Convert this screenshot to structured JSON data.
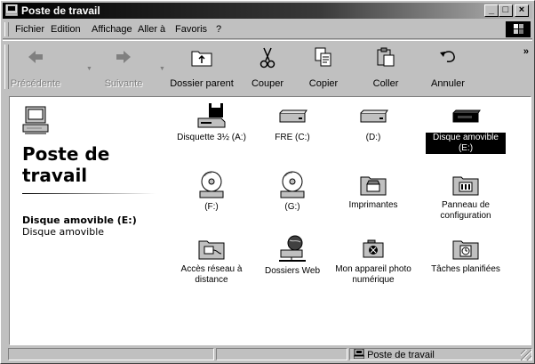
{
  "window": {
    "title": "Poste de travail"
  },
  "menu": [
    {
      "label": "Fichier"
    },
    {
      "label": "Edition"
    },
    {
      "label": "Affichage"
    },
    {
      "label": "Aller à"
    },
    {
      "label": "Favoris"
    },
    {
      "label": "?"
    }
  ],
  "toolbar": {
    "back": "Précédente",
    "forward": "Suivante",
    "parent": "Dossier parent",
    "cut": "Couper",
    "copy": "Copier",
    "paste": "Coller",
    "undo": "Annuler",
    "more": "»"
  },
  "left_pane": {
    "title_line1": "Poste de",
    "title_line2": "travail",
    "selected_name": "Disque amovible (E:)",
    "selected_type": "Disque amovible"
  },
  "items": [
    {
      "label": "Disquette 3½ (A:)",
      "icon": "floppy-drive-icon"
    },
    {
      "label": "FRE (C:)",
      "icon": "hard-drive-icon"
    },
    {
      "label": "(D:)",
      "icon": "hard-drive-icon"
    },
    {
      "label": "Disque amovible (E:)",
      "icon": "removable-disk-icon",
      "selected": true
    },
    {
      "label": "(F:)",
      "icon": "cd-drive-icon"
    },
    {
      "label": "(G:)",
      "icon": "cd-drive-icon"
    },
    {
      "label": "Imprimantes",
      "icon": "printers-folder-icon"
    },
    {
      "label": "Panneau de configuration",
      "icon": "control-panel-icon"
    },
    {
      "label": "Accès réseau à distance",
      "icon": "dialup-networking-icon"
    },
    {
      "label": "Dossiers Web",
      "icon": "web-folders-icon"
    },
    {
      "label": "Mon appareil photo numérique",
      "icon": "camera-folder-icon"
    },
    {
      "label": "Tâches planifiées",
      "icon": "scheduled-tasks-icon"
    }
  ],
  "status": {
    "location": "Poste de travail"
  }
}
